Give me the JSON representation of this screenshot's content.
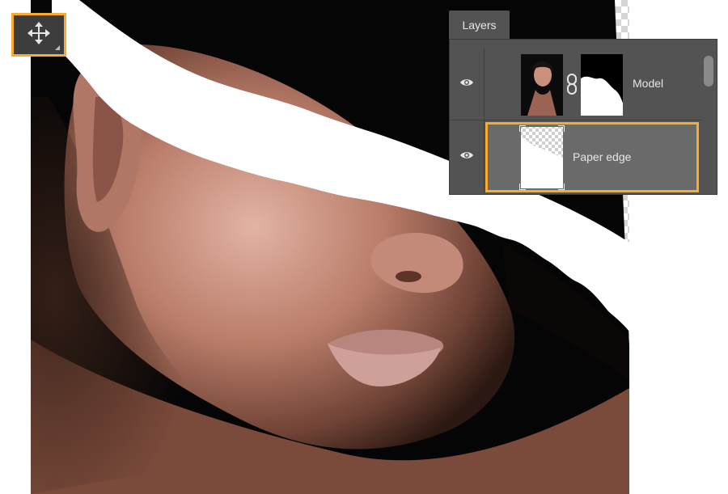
{
  "tool": {
    "name": "Move Tool",
    "icon": "move-icon"
  },
  "panel": {
    "tab_label": "Layers",
    "layers": [
      {
        "name": "Model",
        "visible": true,
        "selected": false,
        "linked_mask": true
      },
      {
        "name": "Paper edge",
        "visible": true,
        "selected": true,
        "linked_mask": false
      }
    ]
  },
  "colors": {
    "highlight": "#f7ac2d",
    "panel_bg": "#535353",
    "selected_row": "#6a6a6a"
  }
}
